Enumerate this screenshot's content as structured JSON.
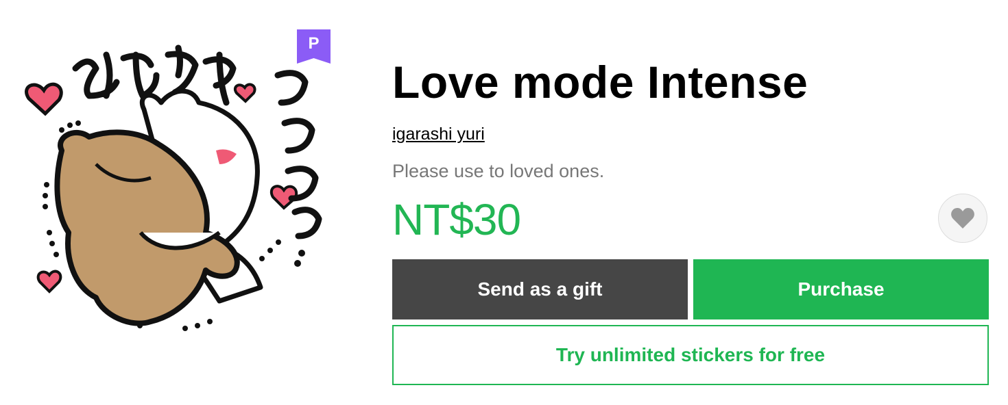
{
  "sticker": {
    "image": "sticker-illustration",
    "premium_badge": "P"
  },
  "product": {
    "title": "Love mode Intense",
    "author": "igarashi yuri",
    "description": "Please use to loved ones.",
    "price": "NT$30"
  },
  "actions": {
    "gift_label": "Send as a gift",
    "purchase_label": "Purchase",
    "try_label": "Try unlimited stickers for free",
    "favorite_icon": "heart-icon"
  },
  "colors": {
    "accent_green": "#1fb653",
    "gift_button": "#464646",
    "premium_purple": "#8b5cf6"
  }
}
